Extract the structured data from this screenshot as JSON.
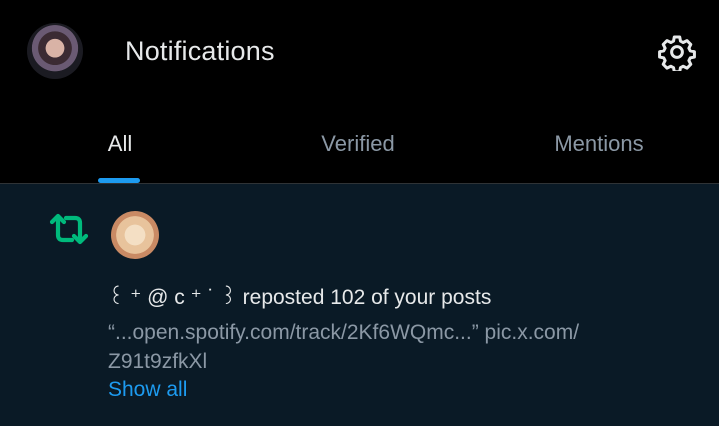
{
  "header": {
    "title": "Notifications",
    "avatar_icon": "profile-avatar",
    "settings_icon": "gear-icon"
  },
  "tabs": [
    {
      "label": "All",
      "active": true
    },
    {
      "label": "Verified",
      "active": false
    },
    {
      "label": "Mentions",
      "active": false
    }
  ],
  "notification": {
    "icon": "repost-icon",
    "actor_name": "꒰ ⁺ @ c ⁺ ˙ ꒱",
    "action_text": "reposted 102 of your posts",
    "preview_line1": "“...open.spotify.com/track/2Kf6WQmc...” pic.x.com/",
    "preview_line2": "Z91t9zfkXl",
    "show_all": "Show all"
  },
  "colors": {
    "background": "#000000",
    "notification_bg": "#0a1a26",
    "accent": "#1d9bf0",
    "repost_green": "#00ba7c",
    "muted_text": "#8b98a5"
  }
}
